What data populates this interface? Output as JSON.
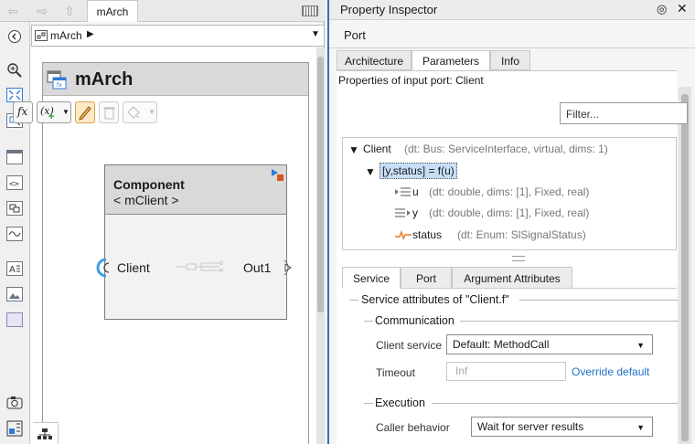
{
  "editor": {
    "model_tab": "mArch",
    "address": "mArch",
    "architecture_title": "mArch",
    "component": {
      "name": "Component",
      "reference": "< mClient >",
      "ports": {
        "client": "Client",
        "output": "Out1"
      }
    }
  },
  "inspector": {
    "title": "Property Inspector",
    "element_type": "Port",
    "tabs": [
      "Architecture",
      "Parameters",
      "Info"
    ],
    "active_tab": "Parameters",
    "heading": "Properties of input port: Client",
    "filter_placeholder": "Filter...",
    "toolbar": {
      "fx": "fx",
      "fx_add": "(x)"
    },
    "tree": {
      "root": {
        "name": "Client",
        "detail": "(dt: Bus: ServiceInterface, virtual, dims: 1)"
      },
      "function": {
        "name": "[y,status] = f(u)"
      },
      "args": [
        {
          "name": "u",
          "detail": "(dt: double, dims: [1], Fixed, real)"
        },
        {
          "name": "y",
          "detail": "(dt: double, dims: [1], Fixed, real)"
        },
        {
          "name": "status",
          "detail": "(dt: Enum: SlSignalStatus)"
        }
      ]
    },
    "sub_tabs": [
      "Service",
      "Port",
      "Argument Attributes"
    ],
    "service": {
      "group_title": "Service attributes of \"Client.f\"",
      "communication": {
        "title": "Communication",
        "client_service_label": "Client service",
        "client_service_value": "Default: MethodCall",
        "timeout_label": "Timeout",
        "timeout_value": "Inf",
        "override_link": "Override default"
      },
      "execution": {
        "title": "Execution",
        "caller_behavior_label": "Caller behavior",
        "caller_behavior_value": "Wait for server results"
      }
    }
  },
  "colors": {
    "accent": "#3b6fb5",
    "selection": "#c7def7",
    "link": "#1f6fc5",
    "port_highlight": "#3c9fe0"
  },
  "icons": [
    "back-arrow-icon",
    "forward-arrow-icon",
    "up-arrow-icon",
    "keyboard-icon",
    "zoom-icon",
    "fit-view-icon",
    "model-icon",
    "chevron-down-icon",
    "menu-icon",
    "close-icon",
    "pencil-icon",
    "trash-icon",
    "paint-bucket-icon",
    "hierarchy-icon",
    "camera-icon"
  ]
}
